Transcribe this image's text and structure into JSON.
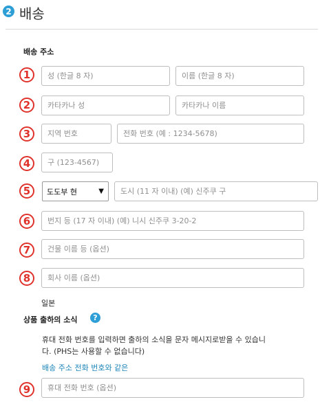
{
  "section": {
    "step_number": "2",
    "title": "배송"
  },
  "address_label": "배송 주소",
  "markers": [
    "1",
    "2",
    "3",
    "4",
    "5",
    "6",
    "7",
    "8",
    "9"
  ],
  "fields": {
    "surname": "성 (한글 8 자)",
    "given_name": "이름 (한글 8 자)",
    "katakana_surname": "카타카나 성",
    "katakana_given": "카타카나 이름",
    "area_code": "지역 번호",
    "phone": "전화 번호 (예 : 1234-5678)",
    "postal_code": "구 (123-4567)",
    "city": "도시 (11 자 이내) (예) 신주쿠 구",
    "street": "번지 등 (17 자 이내) (예) 니시 신주쿠 3-20-2",
    "building": "건물 이름 등 (옵션)",
    "company": "회사 이름 (옵션)",
    "mobile": "휴대 전화 번호 (옵션)"
  },
  "prefecture_select": {
    "value": "도도부 현",
    "arrow": "▼"
  },
  "country": "일본",
  "notify": {
    "title": "상품 출하의 소식",
    "help_icon": "?",
    "description_line1": "휴대 전화 번호를 입력하면 출하의 소식을 문자 메시지로받을 수 있습니",
    "description_line2": "다. (PHS는 사용할 수 없습니다)",
    "same_phone_link": "배송 주소 전화 번호와 같은"
  }
}
